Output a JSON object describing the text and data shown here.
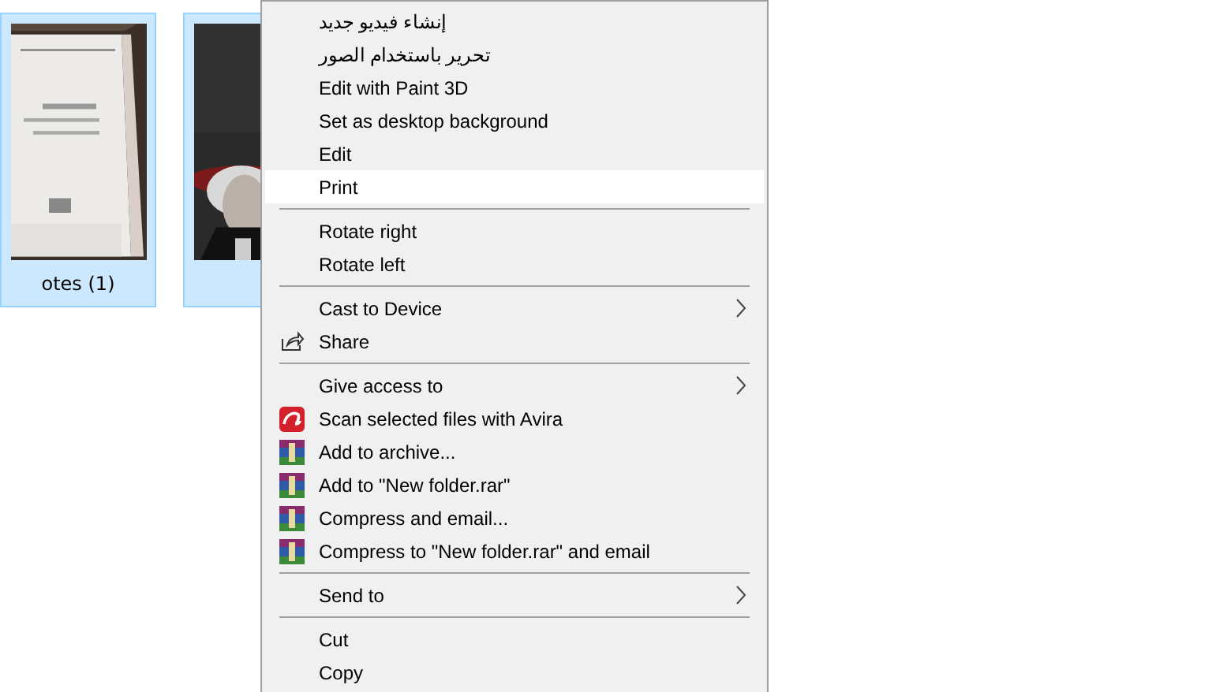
{
  "files": [
    {
      "kind": "picture",
      "name": "otes (1)",
      "selected": true
    },
    {
      "kind": "picture",
      "selected": true
    }
  ],
  "context_menu": {
    "items": [
      {
        "kind": "plain",
        "label": "إنشاء فيديو جديد",
        "selected": false,
        "submenu": false
      },
      {
        "kind": "plain",
        "label": "تحرير باستخدام الصور",
        "selected": false,
        "submenu": false
      },
      {
        "kind": "plain",
        "label": "Edit with Paint 3D",
        "selected": false,
        "submenu": false
      },
      {
        "kind": "plain",
        "label": "Set as desktop background",
        "selected": false,
        "submenu": false
      },
      {
        "kind": "plain",
        "label": "Edit",
        "selected": false,
        "submenu": false
      },
      {
        "kind": "plain",
        "label": "Print",
        "selected": true,
        "submenu": false
      },
      {
        "kind": "separator"
      },
      {
        "kind": "plain",
        "label": "Rotate right",
        "selected": false,
        "submenu": false
      },
      {
        "kind": "plain",
        "label": "Rotate left",
        "selected": false,
        "submenu": false
      },
      {
        "kind": "separator"
      },
      {
        "kind": "plain",
        "label": "Cast to Device",
        "selected": false,
        "submenu": true
      },
      {
        "kind": "share",
        "label": "Share",
        "selected": false,
        "submenu": false
      },
      {
        "kind": "separator"
      },
      {
        "kind": "plain",
        "label": "Give access to",
        "selected": false,
        "submenu": true
      },
      {
        "kind": "scan",
        "label": "Scan selected files with Avira",
        "selected": false,
        "submenu": false
      },
      {
        "kind": "archive",
        "label": "Add to archive...",
        "selected": false,
        "submenu": false
      },
      {
        "kind": "archive",
        "label": "Add to \"New folder.rar\"",
        "selected": false,
        "submenu": false
      },
      {
        "kind": "archive",
        "label": "Compress and email...",
        "selected": false,
        "submenu": false
      },
      {
        "kind": "archive",
        "label": "Compress to \"New folder.rar\" and email",
        "selected": false,
        "submenu": false
      },
      {
        "kind": "separator"
      },
      {
        "kind": "plain",
        "label": "Send to",
        "selected": false,
        "submenu": true
      },
      {
        "kind": "separator"
      },
      {
        "kind": "plain",
        "label": "Cut",
        "selected": false,
        "submenu": false
      },
      {
        "kind": "plain",
        "label": "Copy",
        "selected": false,
        "submenu": false
      }
    ]
  }
}
